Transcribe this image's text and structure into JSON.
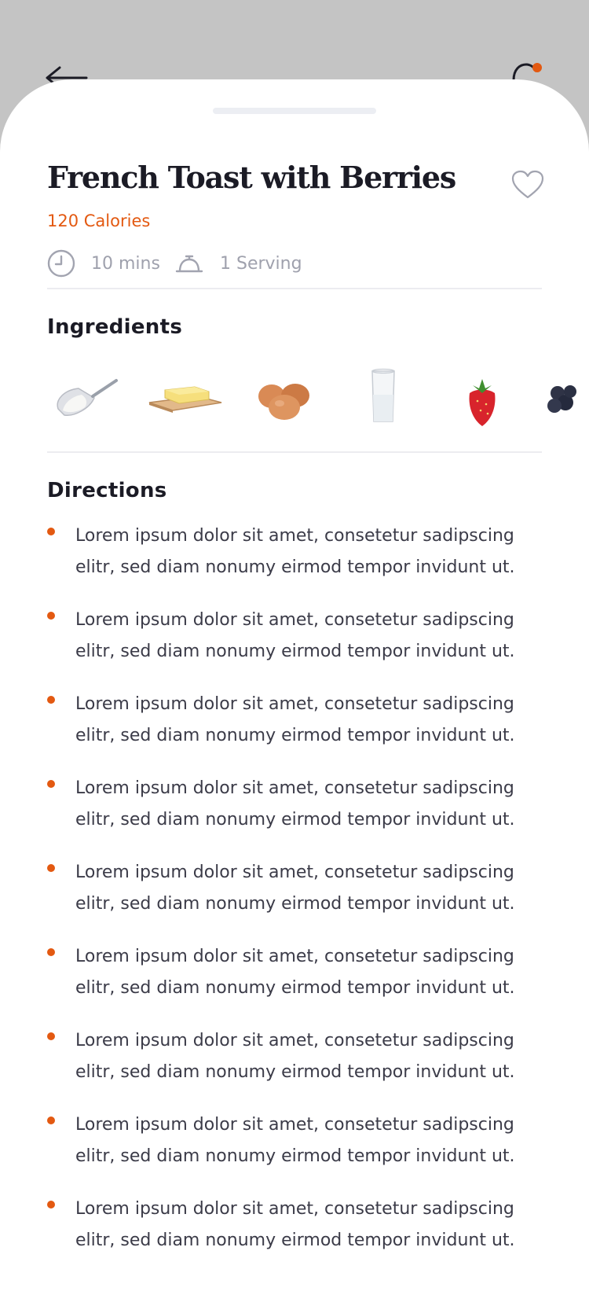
{
  "header": {
    "back_icon": "arrow-left-icon",
    "basket_icon": "basket-icon",
    "accent": "#e35911"
  },
  "recipe": {
    "title": "French Toast with Berries",
    "calories": "120 Calories",
    "time": "10 mins",
    "servings": "1 Serving",
    "favorite_icon": "heart-icon"
  },
  "ingredients": {
    "heading": "Ingredients",
    "items": [
      {
        "icon": "flour-scoop-icon"
      },
      {
        "icon": "butter-icon"
      },
      {
        "icon": "eggs-icon"
      },
      {
        "icon": "milk-glass-icon"
      },
      {
        "icon": "strawberry-icon"
      },
      {
        "icon": "blueberries-icon"
      }
    ]
  },
  "directions": {
    "heading": "Directions",
    "steps": [
      "Lorem ipsum dolor sit amet, consetetur sadipscing elitr, sed diam nonumy eirmod tempor invidunt ut.",
      "Lorem ipsum dolor sit amet, consetetur sadipscing elitr, sed diam nonumy eirmod tempor invidunt ut.",
      "Lorem ipsum dolor sit amet, consetetur sadipscing elitr, sed diam nonumy eirmod tempor invidunt ut.",
      "Lorem ipsum dolor sit amet, consetetur sadipscing elitr, sed diam nonumy eirmod tempor invidunt ut.",
      "Lorem ipsum dolor sit amet, consetetur sadipscing elitr, sed diam nonumy eirmod tempor invidunt ut.",
      "Lorem ipsum dolor sit amet, consetetur sadipscing elitr, sed diam nonumy eirmod tempor invidunt ut.",
      "Lorem ipsum dolor sit amet, consetetur sadipscing elitr, sed diam nonumy eirmod tempor invidunt ut.",
      "Lorem ipsum dolor sit amet, consetetur sadipscing elitr, sed diam nonumy eirmod tempor invidunt ut.",
      "Lorem ipsum dolor sit amet, consetetur sadipscing elitr, sed diam nonumy eirmod tempor invidunt ut."
    ]
  }
}
